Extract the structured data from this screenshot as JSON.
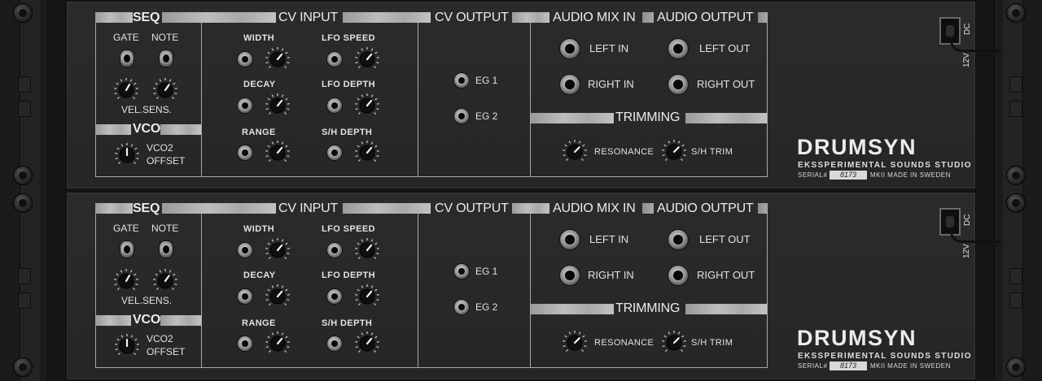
{
  "devices": [
    {
      "id": "unit-1",
      "sections": {
        "seq": "SEQ",
        "cv_input": "CV INPUT",
        "cv_output": "CV OUTPUT",
        "audio_mix_in": "AUDIO MIX IN",
        "audio_output": "AUDIO OUTPUT",
        "vco": "VCO",
        "trimming": "TRIMMING"
      },
      "labels": {
        "gate": "GATE",
        "note": "NOTE",
        "vel_sens": "VEL.SENS.",
        "vco2_offset_1": "VCO2",
        "vco2_offset_2": "OFFSET",
        "width": "WIDTH",
        "lfo_speed": "LFO SPEED",
        "decay": "DECAY",
        "lfo_depth": "LFO DEPTH",
        "range": "RANGE",
        "sh_depth": "S/H DEPTH",
        "eg1": "EG 1",
        "eg2": "EG 2",
        "left_in": "LEFT IN",
        "right_in": "RIGHT IN",
        "left_out": "LEFT OUT",
        "right_out": "RIGHT OUT",
        "resonance": "RESONANCE",
        "sh_trim": "S/H TRIM",
        "dc": "DC",
        "v12": "12V"
      },
      "brand": "DRUMSYN",
      "studio": "EKSSPERIMENTAL SOUNDS STUDIO",
      "serial_label": "SERIAL#",
      "serial_number": "8173",
      "made": "MKII MADE IN SWEDEN"
    },
    {
      "id": "unit-2",
      "sections": {
        "seq": "SEQ",
        "cv_input": "CV INPUT",
        "cv_output": "CV OUTPUT",
        "audio_mix_in": "AUDIO MIX IN",
        "audio_output": "AUDIO OUTPUT",
        "vco": "VCO",
        "trimming": "TRIMMING"
      },
      "labels": {
        "gate": "GATE",
        "note": "NOTE",
        "vel_sens": "VEL.SENS.",
        "vco2_offset_1": "VCO2",
        "vco2_offset_2": "OFFSET",
        "width": "WIDTH",
        "lfo_speed": "LFO SPEED",
        "decay": "DECAY",
        "lfo_depth": "LFO DEPTH",
        "range": "RANGE",
        "sh_depth": "S/H DEPTH",
        "eg1": "EG 1",
        "eg2": "EG 2",
        "left_in": "LEFT IN",
        "right_in": "RIGHT IN",
        "left_out": "LEFT OUT",
        "right_out": "RIGHT OUT",
        "resonance": "RESONANCE",
        "sh_trim": "S/H TRIM",
        "dc": "DC",
        "v12": "12V"
      },
      "brand": "DRUMSYN",
      "studio": "EKSSPERIMENTAL SOUNDS STUDIO",
      "serial_label": "SERIAL#",
      "serial_number": "8173",
      "made": "MKII MADE IN SWEDEN"
    }
  ],
  "colors": {
    "panel": "#2b2b2b",
    "rack": "#151515",
    "text": "#e6e6e6",
    "bar": "#b0b0b0"
  }
}
